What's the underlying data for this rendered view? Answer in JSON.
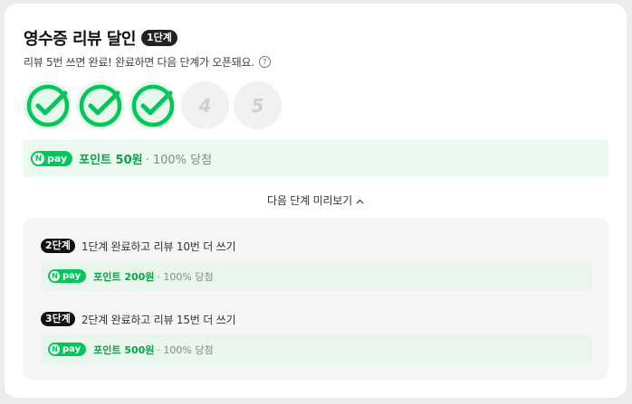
{
  "header": {
    "title": "영수증 리뷰 달인",
    "level_badge": "1단계",
    "subtitle": "리뷰 5번 쓰면 완료! 완료하면 다음 단계가 오픈돼요.",
    "help_icon": "?"
  },
  "stamps": {
    "completed_count": 3,
    "total": 5,
    "pending": [
      "4",
      "5"
    ],
    "check_color": "#03c75a"
  },
  "current_reward": {
    "pay_label": "pay",
    "pay_n": "N",
    "points": "포인트 50원",
    "odds": "· 100% 당첨"
  },
  "preview": {
    "label": "다음 단계 미리보기",
    "chevron": "^"
  },
  "steps": [
    {
      "badge": "2단계",
      "description": "1단계 완료하고 리뷰 10번 더 쓰기",
      "pay_n": "N",
      "pay_label": "pay",
      "points": "포인트 200원",
      "odds": "· 100% 당첨"
    },
    {
      "badge": "3단계",
      "description": "2단계 완료하고 리뷰 15번 더 쓰기",
      "pay_n": "N",
      "pay_label": "pay",
      "points": "포인트 500원",
      "odds": "· 100% 당첨"
    }
  ],
  "colors": {
    "brand_green": "#03c75a",
    "reward_bg": "#ebf9ef",
    "badge_dark": "#222222"
  }
}
